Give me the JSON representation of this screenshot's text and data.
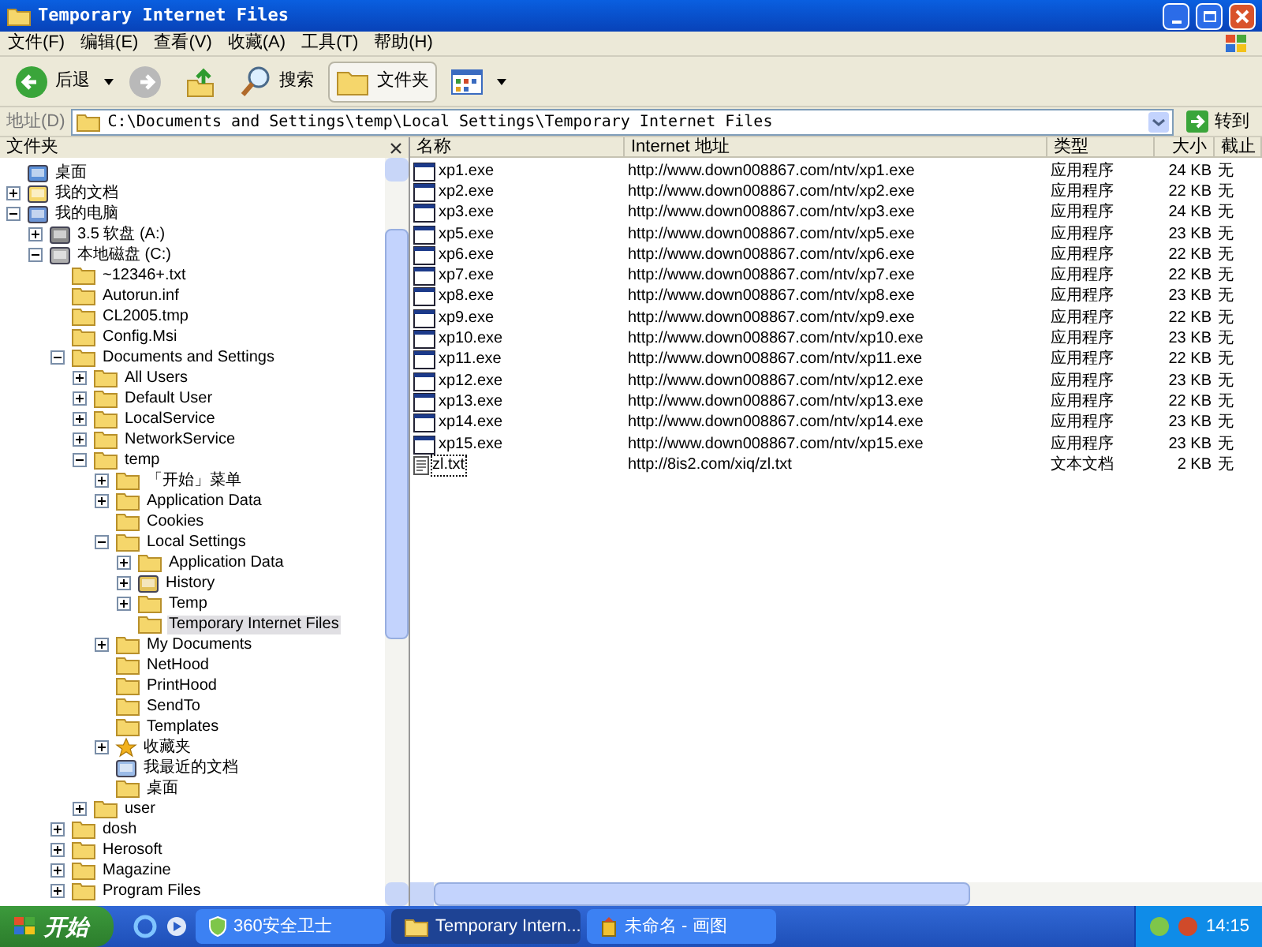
{
  "window": {
    "title": "Temporary Internet Files"
  },
  "menu": [
    "文件(F)",
    "编辑(E)",
    "查看(V)",
    "收藏(A)",
    "工具(T)",
    "帮助(H)"
  ],
  "toolbar": [
    {
      "kind": "back",
      "label": "后退",
      "pressed": false
    },
    {
      "kind": "forward",
      "pressed": false
    },
    {
      "kind": "up",
      "pressed": false
    },
    {
      "kind": "search",
      "label": "搜索",
      "pressed": false
    },
    {
      "kind": "folders",
      "label": "文件夹",
      "pressed": true
    },
    {
      "kind": "views",
      "pressed": false
    }
  ],
  "address": {
    "label": "地址(D)",
    "value": "C:\\Documents and Settings\\temp\\Local Settings\\Temporary Internet Files",
    "go": "转到"
  },
  "folders_pane": {
    "title": "文件夹"
  },
  "tree": [
    {
      "label": "桌面",
      "kind": "desktop",
      "selected": false
    },
    {
      "label": "我的文档",
      "kind": "documents",
      "expanded": false,
      "selected": false
    },
    {
      "label": "我的电脑",
      "kind": "computer",
      "expanded": true,
      "selected": false,
      "children": [
        {
          "label": "3.5 软盘 (A:)",
          "kind": "floppy",
          "expanded": false,
          "selected": false
        },
        {
          "label": "本地磁盘 (C:)",
          "kind": "disk",
          "expanded": true,
          "selected": false,
          "children": [
            {
              "label": "~12346+.txt",
              "kind": "folder",
              "selected": false
            },
            {
              "label": "Autorun.inf",
              "kind": "folder",
              "selected": false
            },
            {
              "label": "CL2005.tmp",
              "kind": "folder",
              "selected": false
            },
            {
              "label": "Config.Msi",
              "kind": "folder",
              "selected": false
            },
            {
              "label": "Documents and Settings",
              "kind": "folder",
              "expanded": true,
              "selected": false,
              "children": [
                {
                  "label": "All Users",
                  "kind": "folder",
                  "expanded": false,
                  "selected": false
                },
                {
                  "label": "Default User",
                  "kind": "folder",
                  "expanded": false,
                  "selected": false
                },
                {
                  "label": "LocalService",
                  "kind": "folder",
                  "expanded": false,
                  "selected": false
                },
                {
                  "label": "NetworkService",
                  "kind": "folder",
                  "expanded": false,
                  "selected": false
                },
                {
                  "label": "temp",
                  "kind": "folder",
                  "expanded": true,
                  "selected": false,
                  "children": [
                    {
                      "label": "「开始」菜单",
                      "kind": "folder",
                      "expanded": false,
                      "selected": false
                    },
                    {
                      "label": "Application Data",
                      "kind": "folder",
                      "expanded": false,
                      "selected": false
                    },
                    {
                      "label": "Cookies",
                      "kind": "folder",
                      "selected": false
                    },
                    {
                      "label": "Local Settings",
                      "kind": "folder",
                      "expanded": true,
                      "selected": false,
                      "children": [
                        {
                          "label": "Application Data",
                          "kind": "folder",
                          "expanded": false,
                          "selected": false
                        },
                        {
                          "label": "History",
                          "kind": "history",
                          "expanded": false,
                          "selected": false
                        },
                        {
                          "label": "Temp",
                          "kind": "folder",
                          "expanded": false,
                          "selected": false
                        },
                        {
                          "label": "Temporary Internet Files",
                          "kind": "folder",
                          "selected": true
                        }
                      ]
                    },
                    {
                      "label": "My Documents",
                      "kind": "folder",
                      "expanded": false,
                      "selected": false
                    },
                    {
                      "label": "NetHood",
                      "kind": "folder",
                      "selected": false
                    },
                    {
                      "label": "PrintHood",
                      "kind": "folder",
                      "selected": false
                    },
                    {
                      "label": "SendTo",
                      "kind": "folder",
                      "selected": false
                    },
                    {
                      "label": "Templates",
                      "kind": "folder",
                      "selected": false
                    },
                    {
                      "label": "收藏夹",
                      "kind": "favorites",
                      "expanded": false,
                      "selected": false
                    },
                    {
                      "label": "我最近的文档",
                      "kind": "recent",
                      "selected": false
                    },
                    {
                      "label": "桌面",
                      "kind": "folder",
                      "selected": false
                    }
                  ]
                },
                {
                  "label": "user",
                  "kind": "folder",
                  "expanded": false,
                  "selected": false
                }
              ]
            },
            {
              "label": "dosh",
              "kind": "folder",
              "expanded": false,
              "selected": false
            },
            {
              "label": "Herosoft",
              "kind": "folder",
              "expanded": false,
              "selected": false
            },
            {
              "label": "Magazine",
              "kind": "folder",
              "expanded": false,
              "selected": false
            },
            {
              "label": "Program Files",
              "kind": "folder",
              "expanded": false,
              "selected": false
            }
          ]
        }
      ]
    }
  ],
  "table": {
    "columns": [
      "名称",
      "Internet 地址",
      "类型",
      "大小",
      "截止"
    ],
    "rows": [
      {
        "kind": "exe",
        "focused": false,
        "cells": [
          "xp1.exe",
          "http://www.down008867.com/ntv/xp1.exe",
          "应用程序",
          "24 KB",
          "无"
        ]
      },
      {
        "kind": "exe",
        "focused": false,
        "cells": [
          "xp2.exe",
          "http://www.down008867.com/ntv/xp2.exe",
          "应用程序",
          "22 KB",
          "无"
        ]
      },
      {
        "kind": "exe",
        "focused": false,
        "cells": [
          "xp3.exe",
          "http://www.down008867.com/ntv/xp3.exe",
          "应用程序",
          "24 KB",
          "无"
        ]
      },
      {
        "kind": "exe",
        "focused": false,
        "cells": [
          "xp5.exe",
          "http://www.down008867.com/ntv/xp5.exe",
          "应用程序",
          "23 KB",
          "无"
        ]
      },
      {
        "kind": "exe",
        "focused": false,
        "cells": [
          "xp6.exe",
          "http://www.down008867.com/ntv/xp6.exe",
          "应用程序",
          "22 KB",
          "无"
        ]
      },
      {
        "kind": "exe",
        "focused": false,
        "cells": [
          "xp7.exe",
          "http://www.down008867.com/ntv/xp7.exe",
          "应用程序",
          "22 KB",
          "无"
        ]
      },
      {
        "kind": "exe",
        "focused": false,
        "cells": [
          "xp8.exe",
          "http://www.down008867.com/ntv/xp8.exe",
          "应用程序",
          "23 KB",
          "无"
        ]
      },
      {
        "kind": "exe",
        "focused": false,
        "cells": [
          "xp9.exe",
          "http://www.down008867.com/ntv/xp9.exe",
          "应用程序",
          "22 KB",
          "无"
        ]
      },
      {
        "kind": "exe",
        "focused": false,
        "cells": [
          "xp10.exe",
          "http://www.down008867.com/ntv/xp10.exe",
          "应用程序",
          "23 KB",
          "无"
        ]
      },
      {
        "kind": "exe",
        "focused": false,
        "cells": [
          "xp11.exe",
          "http://www.down008867.com/ntv/xp11.exe",
          "应用程序",
          "22 KB",
          "无"
        ]
      },
      {
        "kind": "exe",
        "focused": false,
        "cells": [
          "xp12.exe",
          "http://www.down008867.com/ntv/xp12.exe",
          "应用程序",
          "23 KB",
          "无"
        ]
      },
      {
        "kind": "exe",
        "focused": false,
        "cells": [
          "xp13.exe",
          "http://www.down008867.com/ntv/xp13.exe",
          "应用程序",
          "22 KB",
          "无"
        ]
      },
      {
        "kind": "exe",
        "focused": false,
        "cells": [
          "xp14.exe",
          "http://www.down008867.com/ntv/xp14.exe",
          "应用程序",
          "23 KB",
          "无"
        ]
      },
      {
        "kind": "exe",
        "focused": false,
        "cells": [
          "xp15.exe",
          "http://www.down008867.com/ntv/xp15.exe",
          "应用程序",
          "23 KB",
          "无"
        ]
      },
      {
        "kind": "txt",
        "focused": true,
        "cells": [
          "zl.txt",
          "http://8is2.com/xiq/zl.txt",
          "文本文档",
          "2 KB",
          "无"
        ]
      }
    ]
  },
  "taskbar": {
    "start": "开始",
    "tasks": [
      {
        "label": "360安全卫士",
        "kind": "shield",
        "selected": false
      },
      {
        "label": "Temporary Intern...",
        "kind": "folder",
        "selected": true
      },
      {
        "label": "未命名 - 画图",
        "kind": "paint",
        "selected": false
      }
    ],
    "clock": "14:15"
  }
}
